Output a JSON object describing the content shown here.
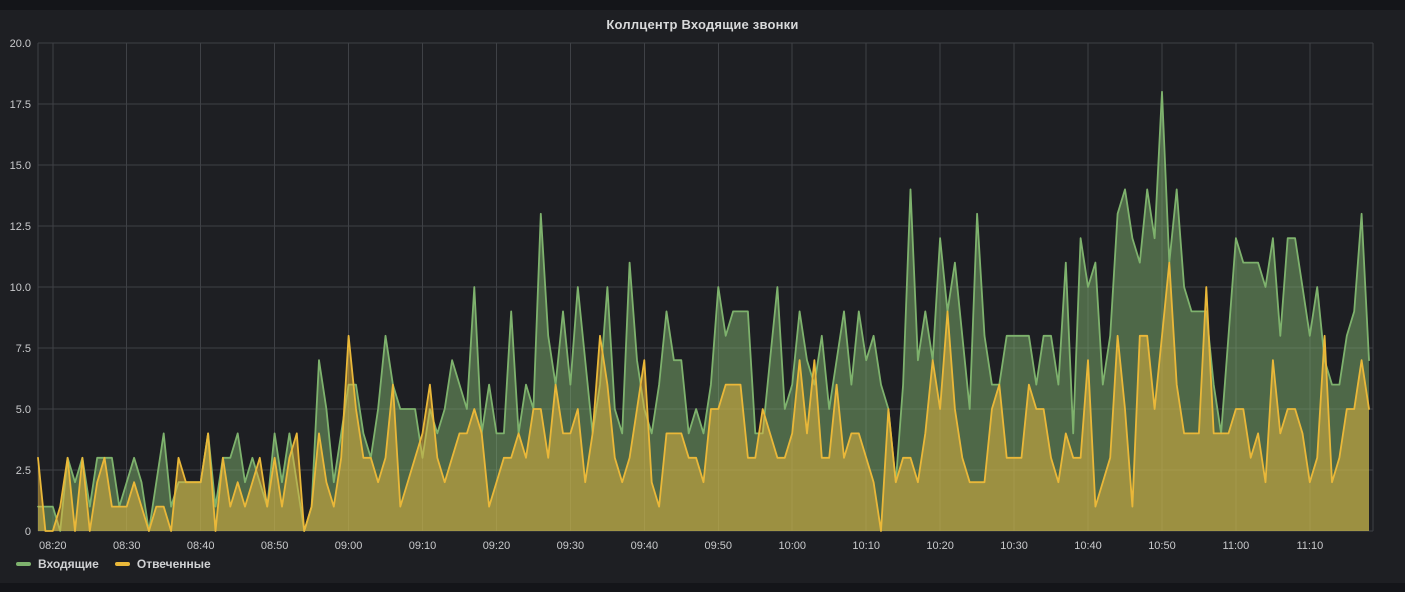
{
  "header": {
    "title": "Коллцентр Входящие звонки"
  },
  "chart_data": {
    "type": "area",
    "title": "Коллцентр Входящие звонки",
    "x_start": "08:18",
    "x_end": "11:18",
    "interval_minutes": 1,
    "ylim": [
      0,
      20
    ],
    "grid": true,
    "legend_position": "bottom-left",
    "y_ticks": [
      {
        "label": "0",
        "value": 0
      },
      {
        "label": "2.5",
        "value": 2.5
      },
      {
        "label": "5.0",
        "value": 5
      },
      {
        "label": "7.5",
        "value": 7.5
      },
      {
        "label": "10.0",
        "value": 10
      },
      {
        "label": "12.5",
        "value": 12.5
      },
      {
        "label": "15.0",
        "value": 15
      },
      {
        "label": "17.5",
        "value": 17.5
      },
      {
        "label": "20.0",
        "value": 20
      }
    ],
    "x_ticks": [
      {
        "label": "08:20",
        "minute": 2
      },
      {
        "label": "08:30",
        "minute": 12
      },
      {
        "label": "08:40",
        "minute": 22
      },
      {
        "label": "08:50",
        "minute": 32
      },
      {
        "label": "09:00",
        "minute": 42
      },
      {
        "label": "09:10",
        "minute": 52
      },
      {
        "label": "09:20",
        "minute": 62
      },
      {
        "label": "09:30",
        "minute": 72
      },
      {
        "label": "09:40",
        "minute": 82
      },
      {
        "label": "09:50",
        "minute": 92
      },
      {
        "label": "10:00",
        "minute": 102
      },
      {
        "label": "10:10",
        "minute": 112
      },
      {
        "label": "10:20",
        "minute": 122
      },
      {
        "label": "10:30",
        "minute": 132
      },
      {
        "label": "10:40",
        "minute": 142
      },
      {
        "label": "10:50",
        "minute": 152
      },
      {
        "label": "11:00",
        "minute": 162
      },
      {
        "label": "11:10",
        "minute": 172
      }
    ],
    "series": [
      {
        "name": "Входящие",
        "color": "#7EB26D",
        "fill_opacity": 0.5,
        "values": [
          1,
          1,
          1,
          0,
          3,
          2,
          3,
          1,
          3,
          3,
          3,
          1,
          2,
          3,
          2,
          0,
          2,
          4,
          1,
          2,
          2,
          2,
          2,
          4,
          1,
          3,
          3,
          4,
          2,
          3,
          2,
          1,
          4,
          2,
          4,
          2,
          0,
          1,
          7,
          5,
          2,
          4,
          6,
          6,
          4,
          3,
          5,
          8,
          6,
          5,
          5,
          5,
          3,
          5,
          4,
          5,
          7,
          6,
          5,
          10,
          4,
          6,
          4,
          4,
          9,
          4,
          6,
          5,
          13,
          8,
          6,
          9,
          6,
          10,
          7,
          4,
          6,
          10,
          5,
          4,
          11,
          7,
          5,
          4,
          6,
          9,
          7,
          7,
          4,
          5,
          4,
          6,
          10,
          8,
          9,
          9,
          9,
          4,
          4,
          7,
          10,
          5,
          6,
          9,
          7,
          6,
          8,
          5,
          7,
          9,
          6,
          9,
          7,
          8,
          6,
          5,
          2,
          6,
          14,
          7,
          9,
          7,
          12,
          9,
          11,
          8,
          5,
          13,
          8,
          6,
          6,
          8,
          8,
          8,
          8,
          6,
          8,
          8,
          6,
          11,
          4,
          12,
          10,
          11,
          6,
          8,
          13,
          14,
          12,
          11,
          14,
          12,
          18,
          11,
          14,
          10,
          9,
          9,
          9,
          6,
          4,
          8,
          12,
          11,
          11,
          11,
          10,
          12,
          8,
          12,
          12,
          10,
          8,
          10,
          7,
          6,
          6,
          8,
          9,
          13,
          7
        ]
      },
      {
        "name": "Отвеченные",
        "color": "#EAB839",
        "fill_opacity": 0.5,
        "values": [
          3,
          0,
          0,
          1,
          3,
          0,
          3,
          0,
          2,
          3,
          1,
          1,
          1,
          2,
          1,
          0,
          1,
          1,
          0,
          3,
          2,
          2,
          2,
          4,
          0,
          3,
          1,
          2,
          1,
          2,
          3,
          1,
          3,
          1,
          3,
          4,
          0,
          1,
          4,
          2,
          1,
          3,
          8,
          5,
          3,
          3,
          2,
          3,
          6,
          1,
          2,
          3,
          4,
          6,
          3,
          2,
          3,
          4,
          4,
          5,
          4,
          1,
          2,
          3,
          3,
          4,
          3,
          5,
          5,
          3,
          6,
          4,
          4,
          5,
          2,
          4,
          8,
          6,
          3,
          2,
          3,
          5,
          7,
          2,
          1,
          4,
          4,
          4,
          3,
          3,
          2,
          5,
          5,
          6,
          6,
          6,
          3,
          3,
          5,
          4,
          3,
          3,
          4,
          7,
          4,
          7,
          3,
          3,
          6,
          3,
          4,
          4,
          3,
          2,
          0,
          5,
          2,
          3,
          3,
          2,
          4,
          7,
          5,
          9,
          5,
          3,
          2,
          2,
          2,
          5,
          6,
          3,
          3,
          3,
          6,
          5,
          5,
          3,
          2,
          4,
          3,
          3,
          7,
          1,
          2,
          3,
          8,
          5,
          1,
          8,
          8,
          5,
          8,
          11,
          6,
          4,
          4,
          4,
          10,
          4,
          4,
          4,
          5,
          5,
          3,
          4,
          2,
          7,
          4,
          5,
          5,
          4,
          2,
          3,
          8,
          2,
          3,
          5,
          5,
          7,
          5
        ]
      }
    ]
  }
}
